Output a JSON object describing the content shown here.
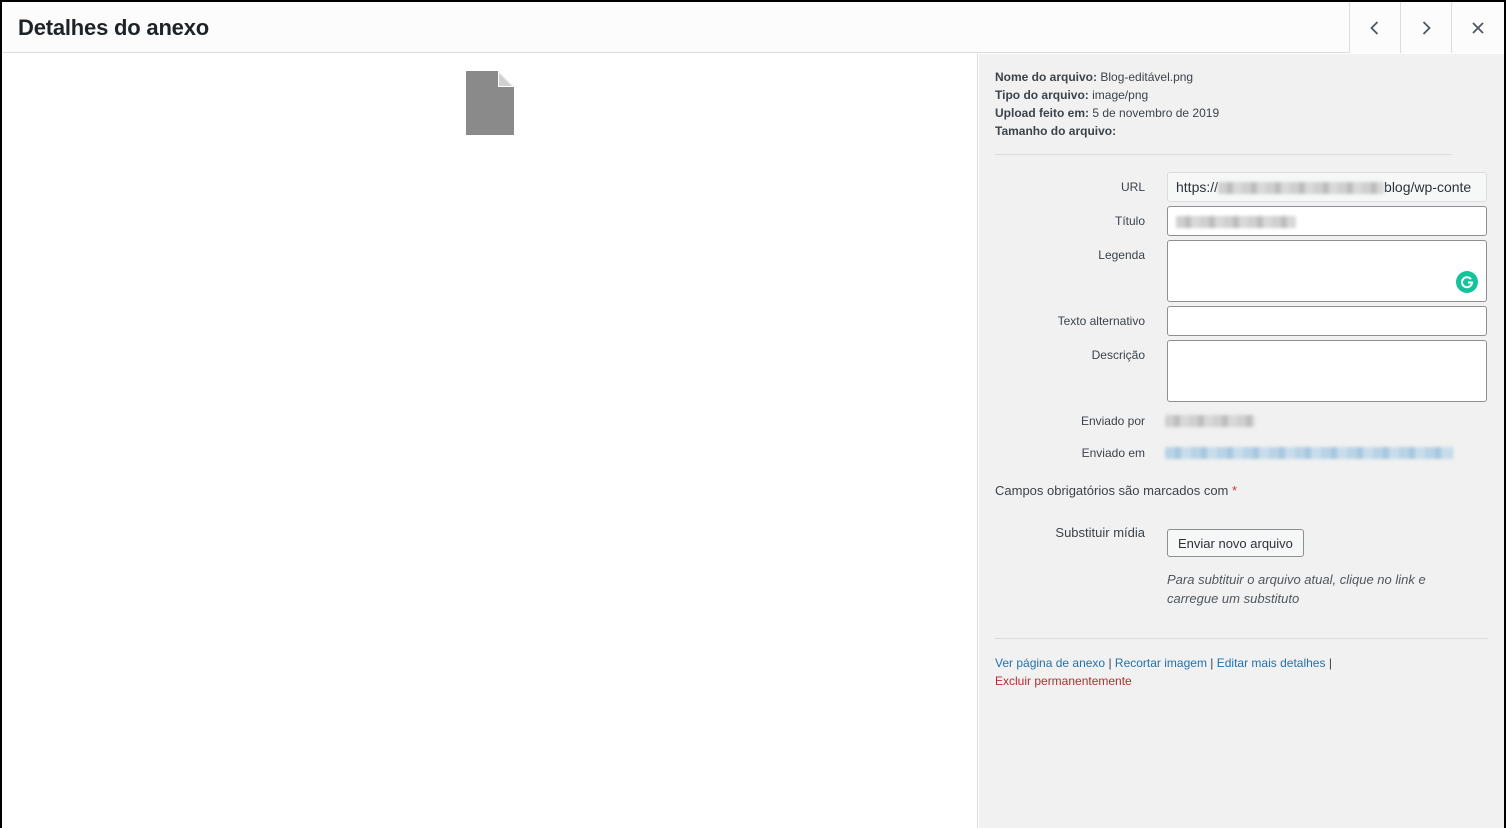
{
  "modal": {
    "title": "Detalhes do anexo"
  },
  "header": {
    "prev_icon": "chevron-left-icon",
    "next_icon": "chevron-right-icon",
    "close_icon": "close-icon"
  },
  "preview": {
    "icon": "document-file-icon"
  },
  "details": {
    "filename_label": "Nome do arquivo:",
    "filename_value": "Blog-editável.png",
    "filetype_label": "Tipo do arquivo:",
    "filetype_value": "image/png",
    "uploaded_label": "Upload feito em:",
    "uploaded_value": "5 de novembro de 2019",
    "filesize_label": "Tamanho do arquivo:"
  },
  "form": {
    "url_label": "URL",
    "url_prefix": "https://",
    "url_suffix": "blog/wp-conte",
    "title_label": "Título",
    "caption_label": "Legenda",
    "alt_label": "Texto alternativo",
    "description_label": "Descrição",
    "uploaded_by_label": "Enviado por",
    "uploaded_to_label": "Enviado em"
  },
  "required_note": "Campos obrigatórios são marcados com",
  "required_star": "*",
  "replace": {
    "label": "Substituir mídia",
    "button": "Enviar novo arquivo",
    "hint": "Para subtituir o arquivo atual, clique no link e carregue um substituto"
  },
  "actions": {
    "view": "Ver página de anexo",
    "crop": "Recortar imagem",
    "edit": "Editar mais detalhes",
    "delete": "Excluir permanentemente",
    "separator": "|"
  },
  "colors": {
    "link": "#2271b1",
    "danger": "#b32d2e",
    "grammarly": "#15c39a"
  }
}
